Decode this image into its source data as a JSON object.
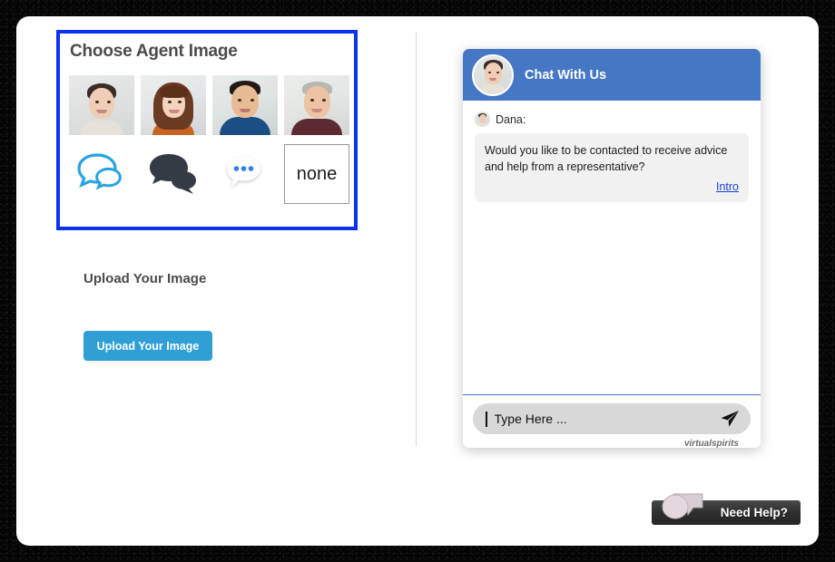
{
  "page": {
    "background_color": "#050505",
    "card_color": "#ffffff"
  },
  "left_panel": {
    "choose_section": {
      "title": "Choose Agent Image",
      "selected_border_color": "#0b33ee",
      "avatars": [
        {
          "name": "agent-photo-woman-short-hair",
          "alt": "Woman with short dark hair"
        },
        {
          "name": "agent-photo-woman-long-hair",
          "alt": "Woman with long brown hair"
        },
        {
          "name": "agent-photo-man-blue-shirt",
          "alt": "Man in blue shirt"
        },
        {
          "name": "agent-photo-man-gray-hair",
          "alt": "Older man with gray hair"
        }
      ],
      "icons": [
        {
          "name": "chat-bubbles-outline-blue-icon",
          "style": "outline-blue"
        },
        {
          "name": "chat-bubbles-solid-dark-icon",
          "style": "solid-dark"
        },
        {
          "name": "chat-bubble-dots-icon",
          "style": "white-with-blue-dots"
        },
        {
          "name": "none-option",
          "label": "none"
        }
      ]
    },
    "upload_section": {
      "heading": "Upload Your Image",
      "button_label": "Upload Your Image",
      "button_color": "#2f9fd6"
    }
  },
  "chat_widget": {
    "header": {
      "title": "Chat With Us",
      "color": "#4577c4",
      "avatar_name": "chat-header-avatar"
    },
    "message": {
      "sender": "Dana:",
      "text": "Would you like to be contacted to receive advice and help from a representative?",
      "action_label": "Intro",
      "link_color": "#1a3fd6",
      "bubble_color": "#f1f1f1"
    },
    "input": {
      "placeholder": "Type Here ...",
      "value": "",
      "send_icon": "send-paper-plane-icon"
    },
    "footer": {
      "branding": "virtualspirits"
    }
  },
  "need_help_tab": {
    "label": "Need Help?",
    "icon": "chat-bubbles-icon",
    "background_color": "#2e2e2e"
  }
}
